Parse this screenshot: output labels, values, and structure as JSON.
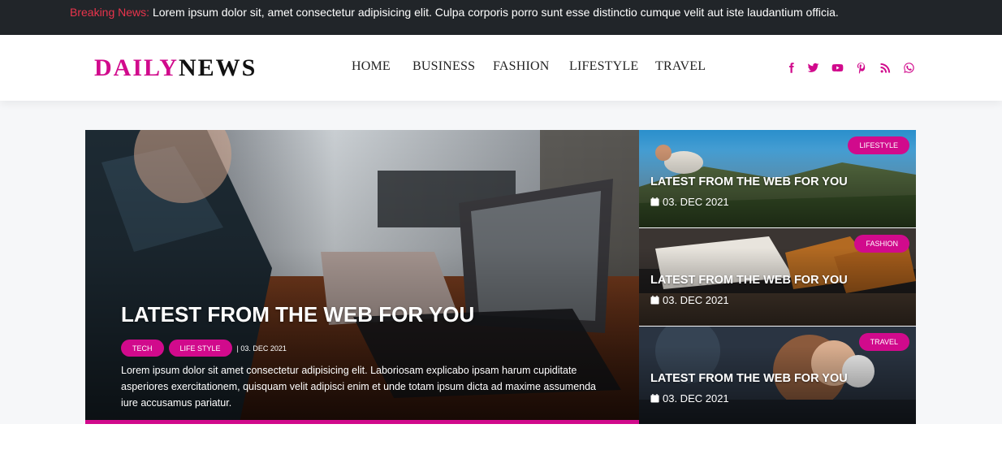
{
  "breaking": {
    "label": "Breaking News:",
    "text": "Lorem ipsum dolor sit, amet consectetur adipisicing elit. Culpa corporis porro sunt esse distinctio cumque velit aut iste laudantium officia."
  },
  "logo": {
    "part1": "DAILY",
    "part2": "NEWS"
  },
  "nav": [
    "HOME",
    "BUSINESS",
    "FASHION",
    "LIFESTYLE",
    "TRAVEL"
  ],
  "social": [
    "facebook-icon",
    "twitter-icon",
    "youtube-icon",
    "pinterest-icon",
    "rss-icon",
    "whatsapp-icon"
  ],
  "colors": {
    "accent": "#d10a8c",
    "topbar": "#212529",
    "breaking_label": "#e8344c",
    "band": "#f6f7f9"
  },
  "feature": {
    "title": "LATEST FROM THE WEB FOR YOU",
    "tags": [
      "TECH",
      "LIFE STYLE"
    ],
    "date": "| 03. DEC 2021",
    "excerpt": "Lorem ipsum dolor sit amet consectetur adipisicing elit. Laboriosam explicabo ipsam harum cupiditate asperiores exercitationem, quisquam velit adipisci enim et unde totam ipsum dicta ad maxime assumenda iure accusamus pariatur."
  },
  "side_posts": [
    {
      "badge": "LIFESTYLE",
      "title": "LATEST FROM THE WEB FOR YOU",
      "date": "03. DEC 2021"
    },
    {
      "badge": "FASHION",
      "title": "LATEST FROM THE WEB FOR YOU",
      "date": "03. DEC 2021"
    },
    {
      "badge": "TRAVEL",
      "title": "LATEST FROM THE WEB FOR YOU",
      "date": "03. DEC 2021"
    }
  ]
}
